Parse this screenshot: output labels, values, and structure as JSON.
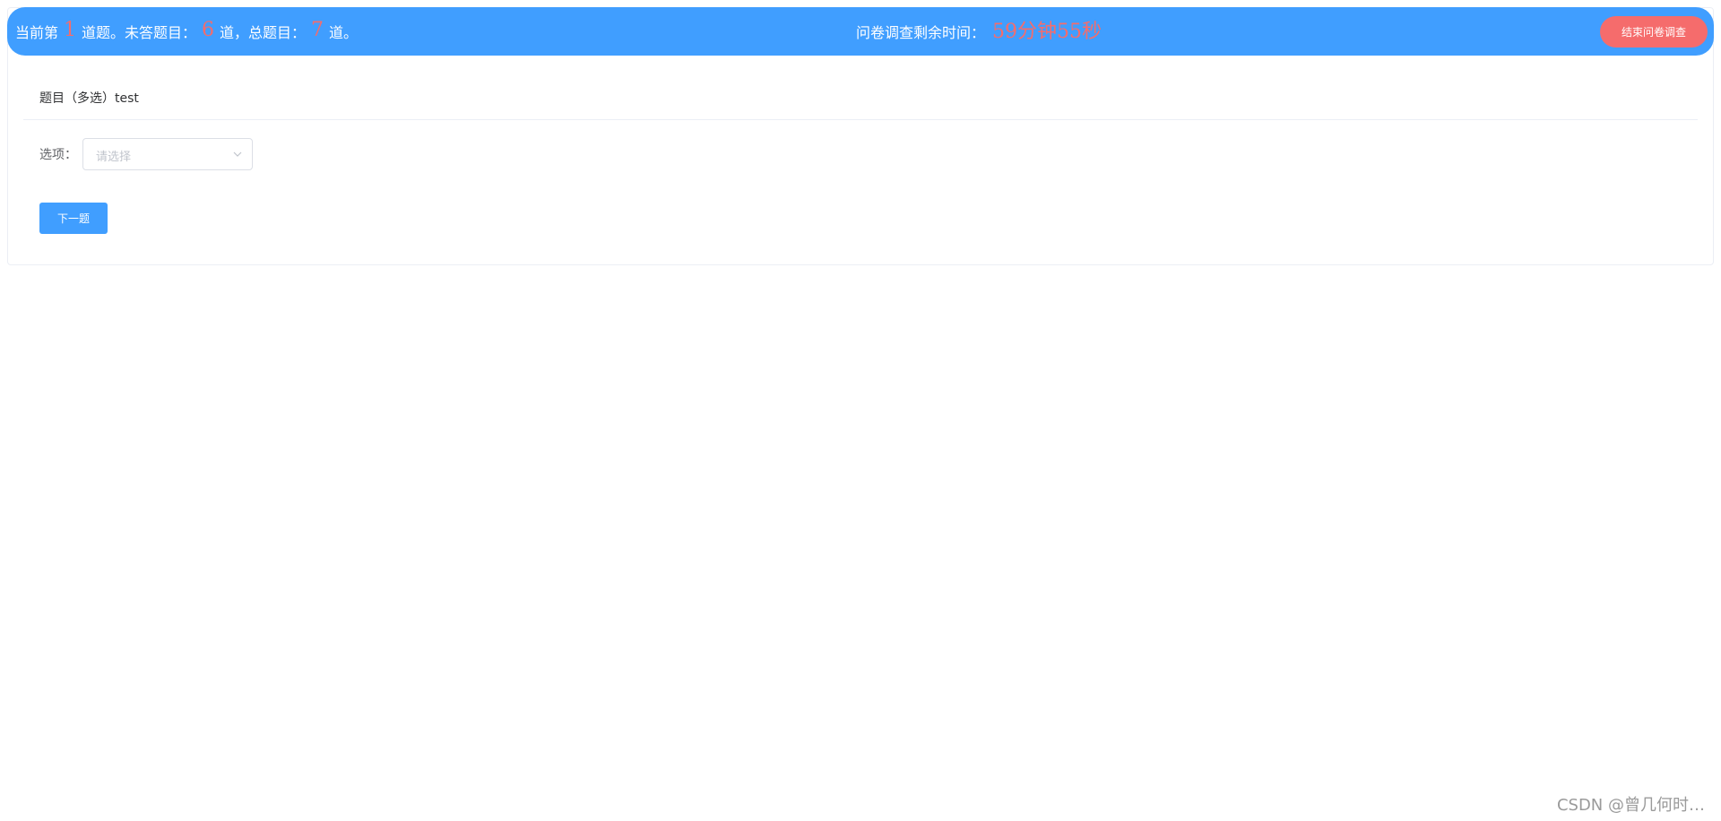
{
  "header": {
    "progress": {
      "prefix": "当前第",
      "current": "1",
      "mid1": "道题。未答题目：",
      "unanswered": "6",
      "mid2": "道，总题目：",
      "total": "7",
      "suffix": "道。"
    },
    "timer": {
      "label": "问卷调查剩余时间：",
      "remaining": "59分钟55秒"
    },
    "end_button": "结束问卷调查"
  },
  "question": {
    "title": "题目（多选）test",
    "option_label": "选项：",
    "select_placeholder": "请选择"
  },
  "actions": {
    "next_button": "下一题"
  },
  "watermark": "CSDN @曾几何时…",
  "colors": {
    "primary": "#409eff",
    "danger": "#f56c6c",
    "placeholder": "#c0c4cc",
    "border": "#dcdfe6"
  },
  "icons": {
    "select_chevron": "chevron-down-icon"
  }
}
